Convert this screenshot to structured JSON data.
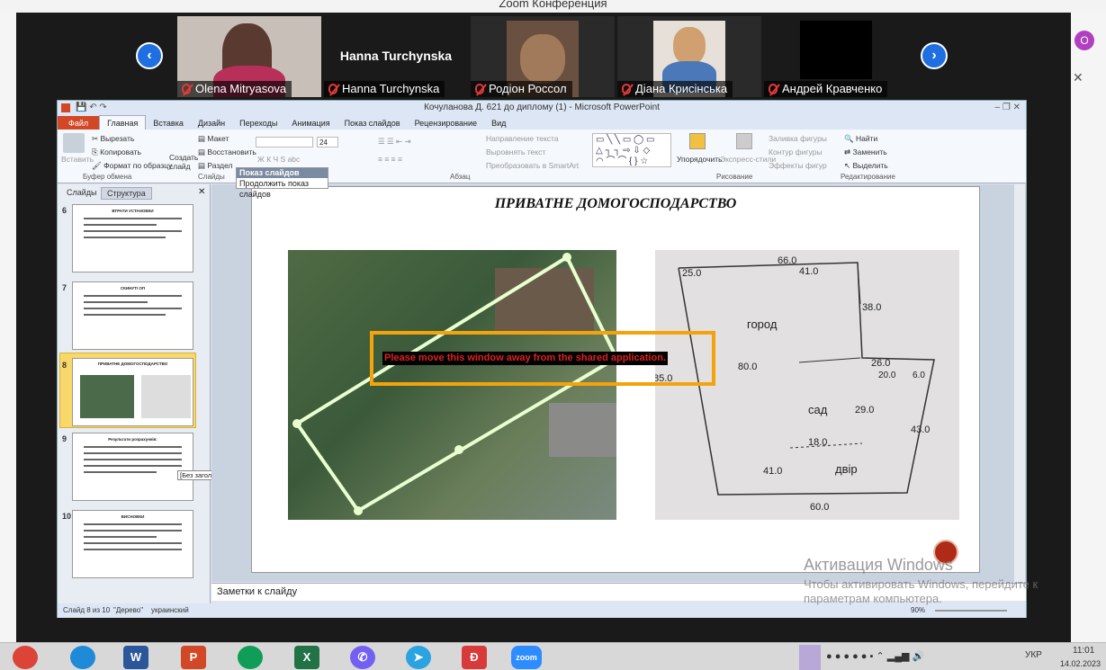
{
  "zoom": {
    "window_title": "Zoom Конференция",
    "participants": [
      {
        "name": "Olena Mitryasova",
        "muted": true,
        "video": true
      },
      {
        "name": "Hanna Turchynska",
        "muted": true,
        "video": false
      },
      {
        "name": "Родіон Россол",
        "muted": true,
        "video": true
      },
      {
        "name": "Діана Крисінська",
        "muted": true,
        "video": true
      },
      {
        "name": "Андрей Кравченко",
        "muted": true,
        "video": false
      }
    ],
    "share_warning": "Please move this window away from the shared application."
  },
  "ppt": {
    "title": "Кочуланова Д. 621 до диплому (1)  -  Microsoft PowerPoint",
    "tabs": [
      "Файл",
      "Главная",
      "Вставка",
      "Дизайн",
      "Переходы",
      "Анимация",
      "Показ слайдов",
      "Рецензирование",
      "Вид"
    ],
    "active_tab": "Главная",
    "ribbon": {
      "paste": "Вставить",
      "cut": "Вырезать",
      "copy": "Копировать",
      "format_painter": "Формат по образцу",
      "clipboard_group": "Буфер обмена",
      "new_slide": "Создать слайд",
      "layout": "Макет",
      "reset": "Восстановить",
      "section": "Раздел",
      "slides_group": "Слайды",
      "font_size": "24",
      "paragraph_group": "Абзац",
      "text_direction": "Направление текста",
      "align_text": "Выровнять текст",
      "smartart": "Преобразовать в SmartArt",
      "arrange": "Упорядочить",
      "quick_styles": "Экспресс-стили",
      "shape_fill": "Заливка фигуры",
      "shape_outline": "Контур фигуры",
      "shape_effects": "Эффекты фигур",
      "drawing_group": "Рисование",
      "find": "Найти",
      "replace": "Заменить",
      "select": "Выделить",
      "editing_group": "Редактирование"
    },
    "slideshow_tooltip": {
      "title": "Показ слайдов",
      "body": "Продолжить показ слайдов"
    },
    "panel_tabs": [
      "Слайды",
      "Структура"
    ],
    "thumbnails": [
      {
        "num": "6",
        "title": "ВТРАТИ УСТАНОВКИ"
      },
      {
        "num": "7",
        "title": "СКИНУТІ ОП"
      },
      {
        "num": "8",
        "title": "ПРИВАТНЕ ДОМОГОСПОДАРСТВО"
      },
      {
        "num": "9",
        "title": "Результати розрахунків:"
      },
      {
        "num": "10",
        "title": "ВИСНОВКИ"
      }
    ],
    "thumb_tooltip": "[Без заголовка]",
    "slide": {
      "title": "ПРИВАТНЕ ДОМОГОСПОДАРСТВО",
      "sketch_labels": [
        "66.0",
        "41.0",
        "25.0",
        "38.0",
        "город",
        "80.0",
        "26.0",
        "20.0",
        "6.0",
        "85.0",
        "сад",
        "29.0",
        "43.0",
        "18.0",
        "двір",
        "41.0",
        "60.0"
      ]
    },
    "notes_placeholder": "Заметки к слайду",
    "status": {
      "slide": "Слайд 8 из 10",
      "theme": "\"Дерево\"",
      "lang": "украинский",
      "zoom": "90%"
    }
  },
  "activation": {
    "title": "Активация Windows",
    "body": "Чтобы активировать Windows, перейдите к параметрам компьютера."
  },
  "taskbar": {
    "apps": [
      "chrome",
      "edge",
      "word",
      "powerpoint",
      "chrome",
      "excel",
      "viber",
      "telegram",
      "app",
      "zoom"
    ],
    "lang": "УКР",
    "time": "11:01",
    "date": "14.02.2023"
  },
  "colors": {
    "zoom_blue": "#1f6fe0",
    "warning_border": "#f5a30a",
    "warning_text": "#e02020",
    "ppt_file_tab": "#d24726"
  }
}
